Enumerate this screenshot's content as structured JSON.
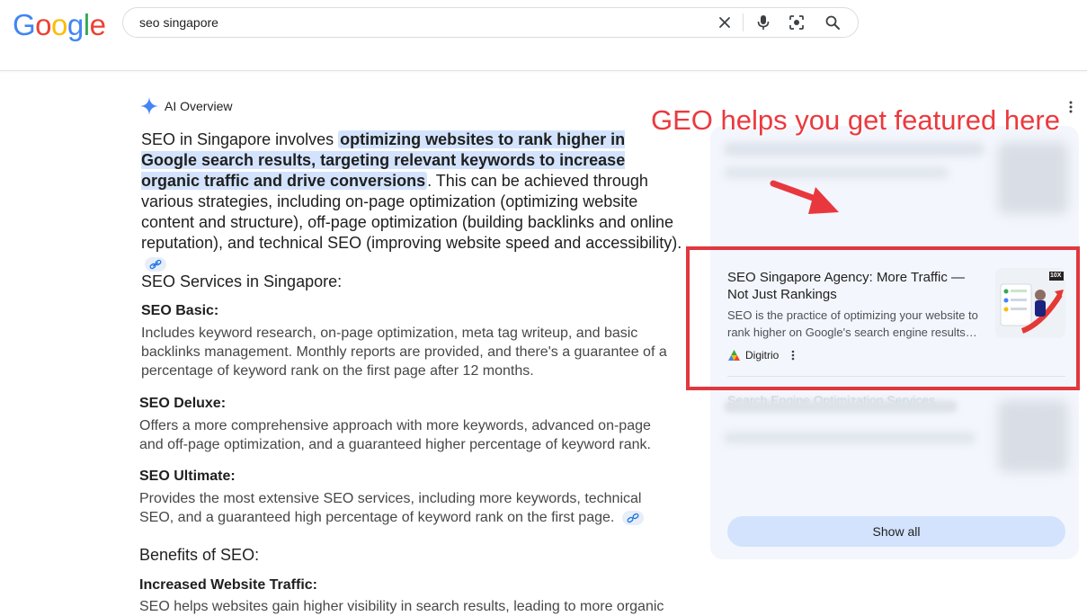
{
  "header": {
    "logo_letters": [
      {
        "ch": "G",
        "color": "#4285f4"
      },
      {
        "ch": "o",
        "color": "#ea4335"
      },
      {
        "ch": "o",
        "color": "#fbbc05"
      },
      {
        "ch": "g",
        "color": "#4285f4"
      },
      {
        "ch": "l",
        "color": "#34a853"
      },
      {
        "ch": "e",
        "color": "#ea4335"
      }
    ],
    "search_query": "seo singapore",
    "icons": [
      "clear-icon",
      "microphone-icon",
      "lens-icon",
      "search-icon"
    ]
  },
  "ai_overview": {
    "label": "AI Overview",
    "intro_prefix": "SEO in Singapore involves ",
    "intro_highlight": "optimizing websites to rank higher in Google search results, targeting relevant keywords to increase organic traffic and drive conversions",
    "intro_rest": ". This can be achieved through various strategies, including on-page optimization (optimizing website content and structure), off-page optimization (building backlinks and online reputation), and technical SEO (improving website speed and accessibility).",
    "services_heading": "SEO Services in Singapore:",
    "basic_title": "SEO Basic:",
    "basic_text": "Includes keyword research, on-page optimization, meta tag writeup, and basic backlinks management. Monthly reports are provided, and there's a guarantee of a percentage of keyword rank on the first page after 12 months.",
    "deluxe_title": "SEO Deluxe:",
    "deluxe_text": "Offers a more comprehensive approach with more keywords, advanced on-page and off-page optimization, and a guaranteed higher percentage of keyword rank.",
    "ultimate_title": "SEO Ultimate:",
    "ultimate_text": "Provides the most extensive SEO services, including more keywords, technical SEO, and a guaranteed high percentage of keyword rank on the first page.",
    "benefits_heading": "Benefits of SEO:",
    "traffic_title": "Increased Website Traffic:",
    "traffic_text": "SEO helps websites gain higher visibility in search results, leading to more organic"
  },
  "sources": {
    "featured_card": {
      "title": "SEO Singapore Agency: More Traffic — Not Just Rankings",
      "description": "SEO is the practice of optimizing your website to rank higher on Google's search engine results…",
      "source_name": "Digitrio",
      "thumb_badge": "10X"
    },
    "faded_title": "Search Engine Optimization Services",
    "show_all_label": "Show all"
  },
  "annotation": {
    "callout_text": "GEO helps you get featured here",
    "color": "#e0383f"
  }
}
